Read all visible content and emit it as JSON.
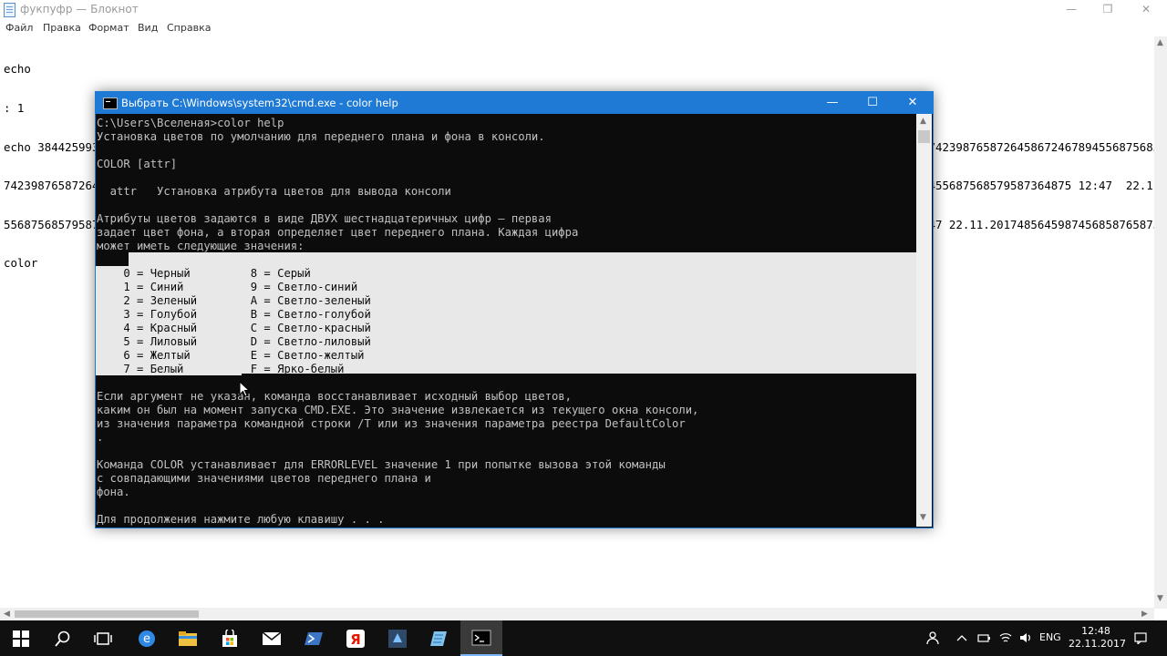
{
  "notepad": {
    "title": "фукпуфр — Блокнот",
    "controls": {
      "minimize": "—",
      "maximize": "❐",
      "close": "✕"
    },
    "menu": [
      "Файл",
      "Правка",
      "Формат",
      "Вид",
      "Справка"
    ],
    "lines": [
      "echo",
      ": 1",
      "echo 3844259938469389467423987658726458672467894556875685795873648751 2:47  22.11.2017485645987456858765875268292894793844259938469389467423987658726458672467894556875685",
      "742398765872645867246789455687568579587364875 2:47  22.11.201748564598745685876587526829289479384425993846938946742398765872645867246789455687568579587364875 12:47  22.11.",
      "556875685795873648751 2:47  22.11.20174856459874568587658752682928947938442599384693894674239876587264586724678945568756857958736487512:47 22.11.2017485645987456858765875",
      "color"
    ]
  },
  "cmd": {
    "title": "Выбрать C:\\Windows\\system32\\cmd.exe - color  help",
    "controls": {
      "minimize": "—",
      "maximize": "☐",
      "close": "✕"
    },
    "lines": [
      "C:\\Users\\Вселеная>color help",
      "Установка цветов по умолчанию для переднего плана и фона в консоли.",
      "",
      "COLOR [attr]",
      "",
      "  attr   Установка атрибута цветов для вывода консоли",
      "",
      "Атрибуты цветов задаются в виде ДВУХ шестнадцатеричных цифр — первая",
      "задает цвет фона, а вторая определяет цвет переднего плана. Каждая цифра",
      "может иметь следующие значения:",
      "",
      "    0 = Черный         8 = Серый",
      "    1 = Синий          9 = Светло-синий",
      "    2 = Зеленый        A = Светло-зеленый",
      "    3 = Голубой        B = Светло-голубой",
      "    4 = Красный        C = Светло-красный",
      "    5 = Лиловый        D = Светло-лиловый",
      "    6 = Желтый         E = Светло-желтый",
      "    7 = Белый          F = Ярко-белый",
      "",
      "Если аргумент не указан, команда восстанавливает исходный выбор цветов,",
      "каким он был на момент запуска CMD.EXE. Это значение извлекается из текущего окна консоли,",
      "из значения параметра командной строки /T или из значения параметра реестра DefaultColor",
      ".",
      "",
      "Команда COLOR устанавливает для ERRORLEVEL значение 1 при попытке вызова этой команды",
      "с совпадающими значениями цветов переднего плана и",
      "фона.",
      "",
      "Для продолжения нажмите любую клавишу . . ."
    ]
  },
  "taskbar": {
    "items": [
      "windows-start",
      "search",
      "task-view",
      "edge",
      "file-explorer",
      "store",
      "mail",
      "powershell",
      "yandex-browser",
      "app-tool",
      "notepad",
      "cmd"
    ],
    "active": "cmd",
    "tray": {
      "lang": "ENG",
      "time": "12:48",
      "date": "22.11.2017"
    }
  },
  "colors": {
    "cmd_accent": "#1f7ad6",
    "cmd_bg": "#0c0c0c",
    "cmd_text": "#c0c0c0",
    "selection": "#e8e8e8",
    "taskbar": "#101010"
  }
}
